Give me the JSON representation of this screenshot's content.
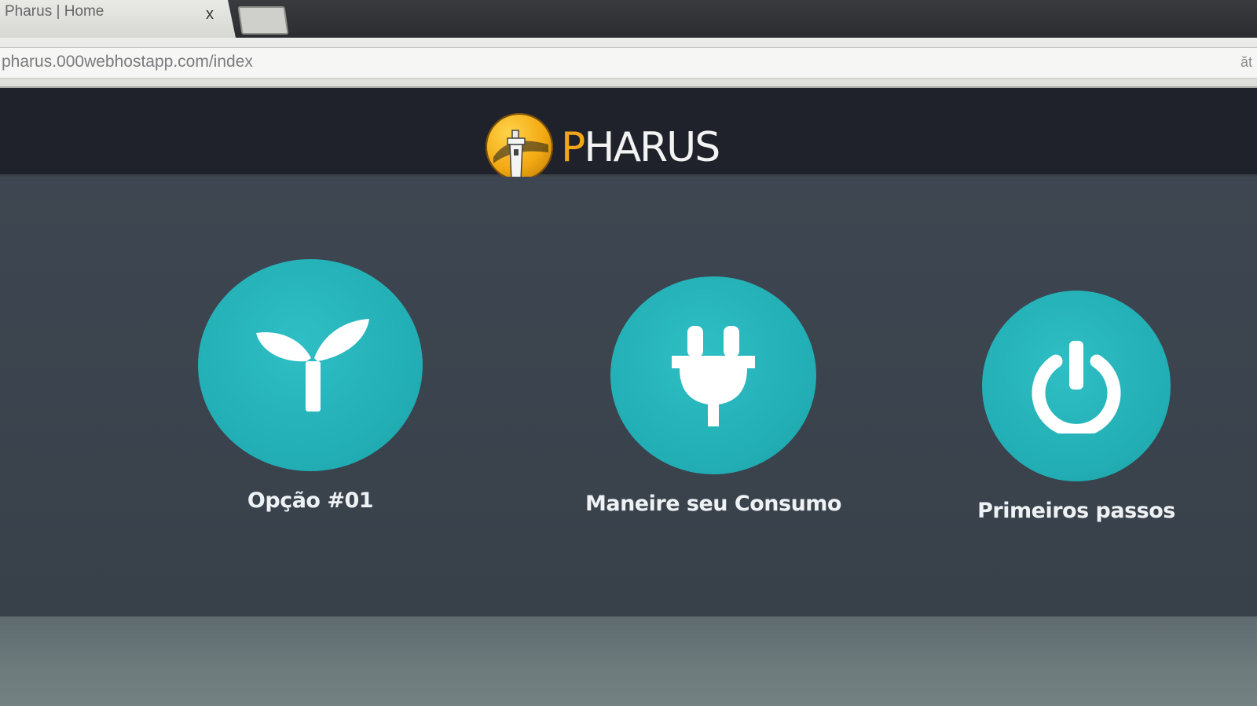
{
  "browser": {
    "tab_title": "Pharus | Home",
    "tab_close": "x",
    "address": "pharus.000webhostapp.com/index",
    "address_right": "ăt"
  },
  "site": {
    "logo_text_first": "P",
    "logo_text_rest": "HARUS",
    "brand_color": "#f2a516",
    "accent_color": "#21adb3"
  },
  "features": [
    {
      "label": "Opção #01",
      "icon": "sprout-icon"
    },
    {
      "label": "Maneire seu Consumo",
      "icon": "plug-icon"
    },
    {
      "label": "Primeiros passos",
      "icon": "power-icon"
    }
  ]
}
